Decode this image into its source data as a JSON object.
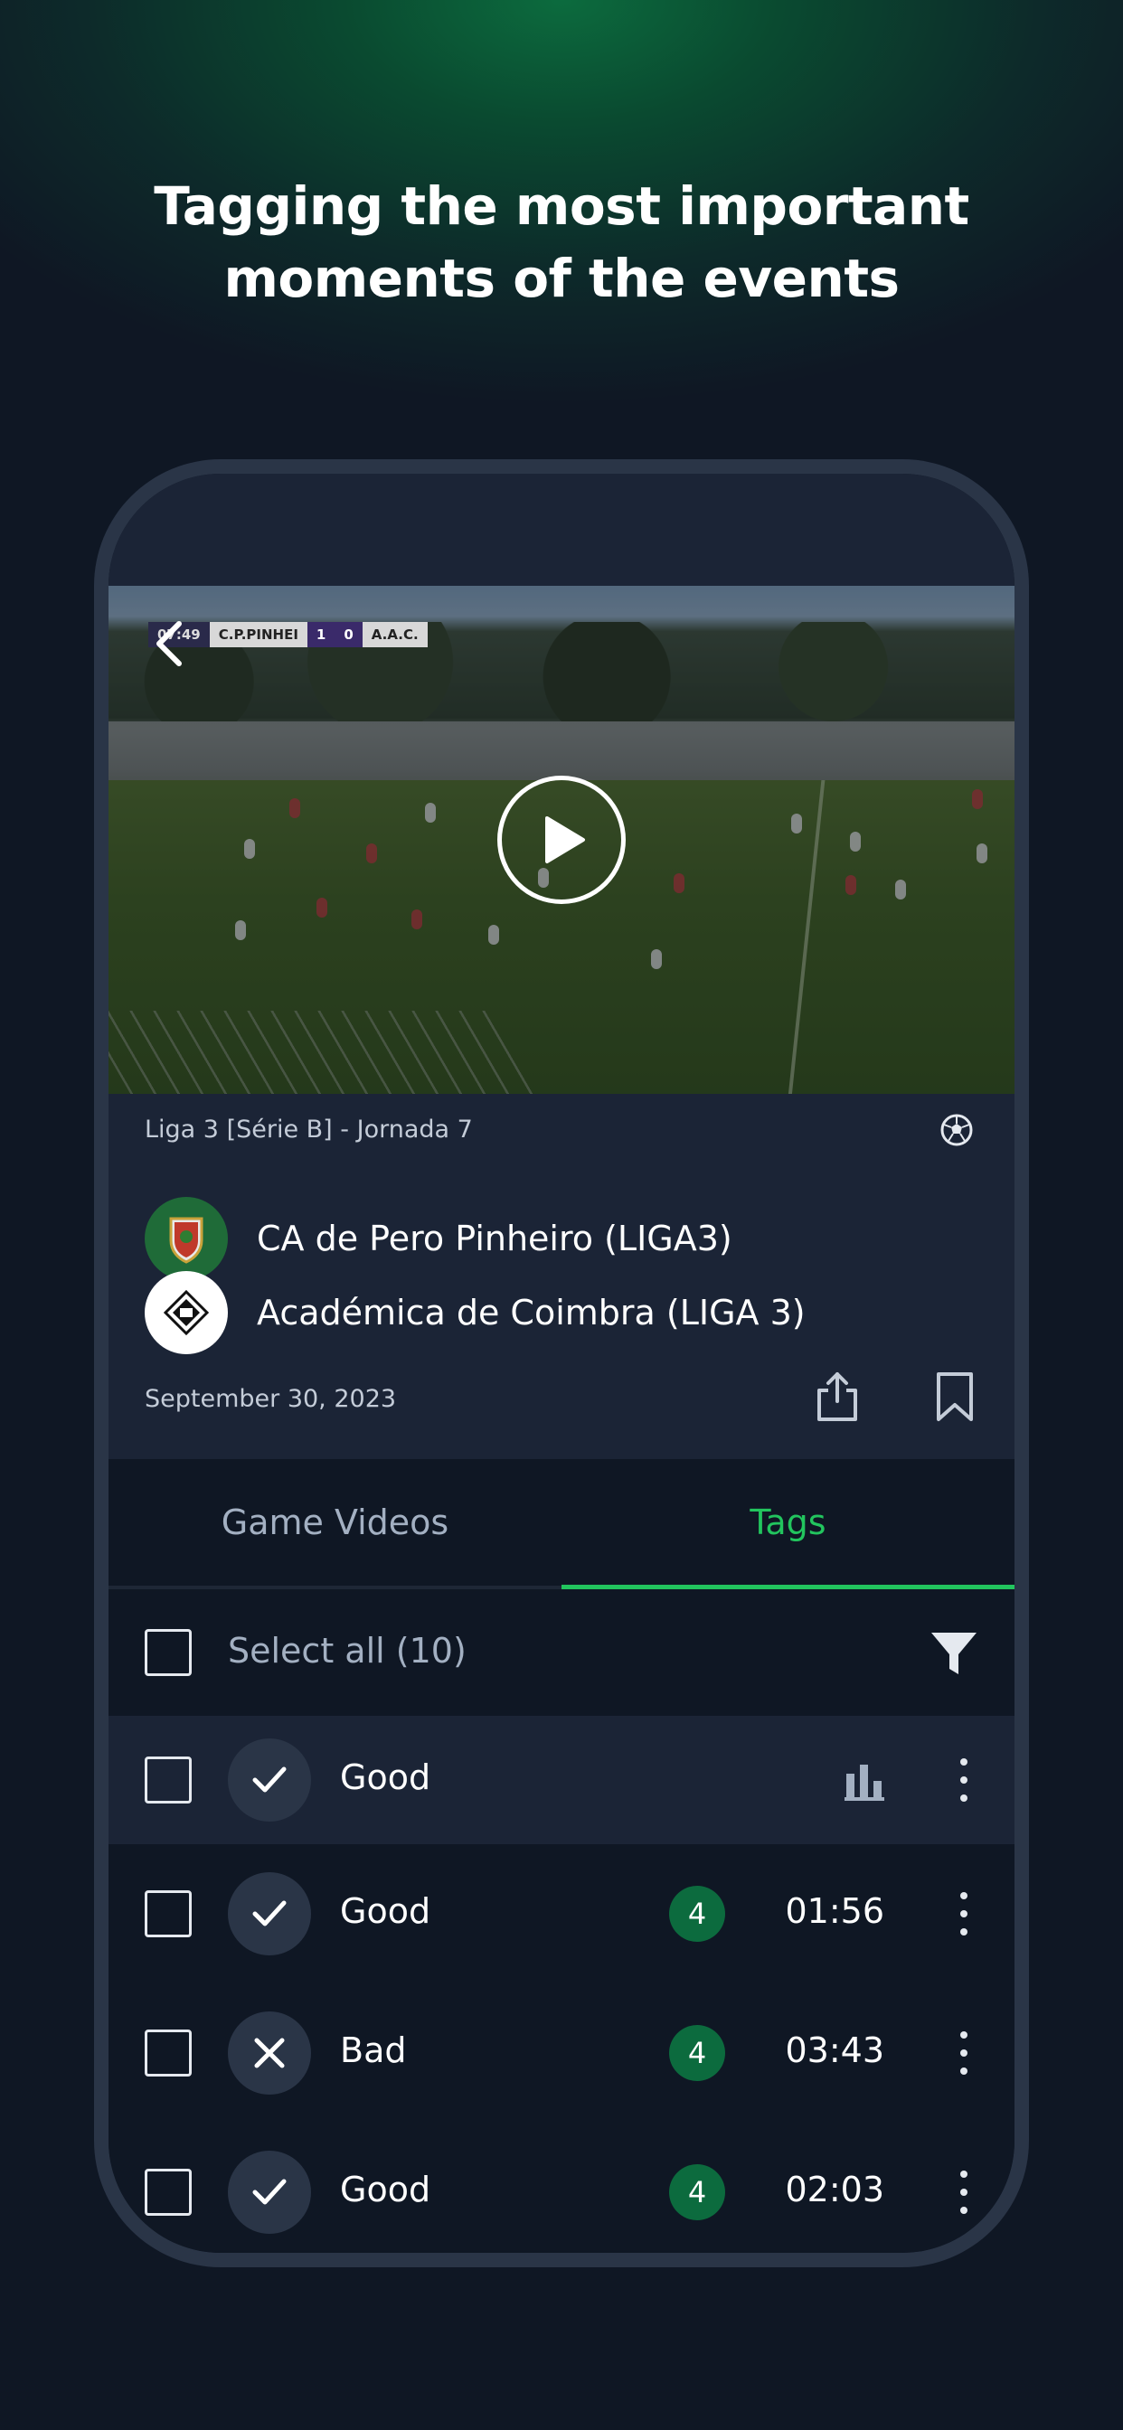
{
  "headline": {
    "line1": "Tagging the most important",
    "line2": "moments of the events"
  },
  "video": {
    "scorebug": {
      "time": "07:49",
      "home": "C.P.PINHEI",
      "home_score": "1",
      "away_score": "0",
      "away": "A.A.C."
    }
  },
  "match": {
    "league": "Liga 3 [Série B] - Jornada 7",
    "home_team": "CA de Pero Pinheiro (LIGA3)",
    "away_team": "Académica de Coimbra (LIGA 3)",
    "date": "September 30, 2023"
  },
  "tabs": [
    {
      "label": "Game Videos",
      "active": false
    },
    {
      "label": "Tags",
      "active": true
    }
  ],
  "select_all_label": "Select all (10)",
  "group": {
    "label": "Good",
    "status": "good"
  },
  "tags": [
    {
      "label": "Good",
      "status": "good",
      "count": "4",
      "time": "01:56"
    },
    {
      "label": "Bad",
      "status": "bad",
      "count": "4",
      "time": "03:43"
    },
    {
      "label": "Good",
      "status": "good",
      "count": "4",
      "time": "02:03"
    }
  ],
  "colors": {
    "accent": "#22c55e",
    "badge": "#0c6b3e",
    "background": "#0f1724",
    "panel": "#1b2436",
    "frame": "#2a3547"
  }
}
